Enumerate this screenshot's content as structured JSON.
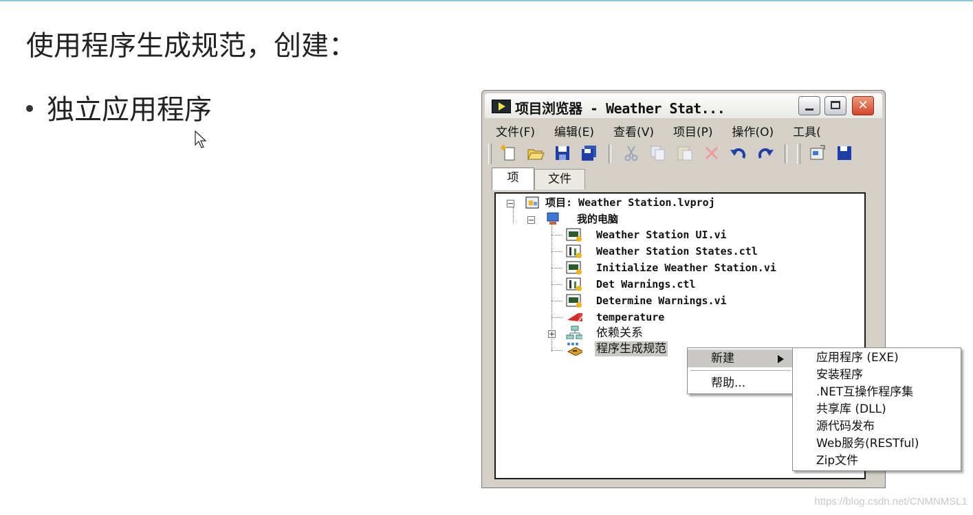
{
  "slide": {
    "title": "使用程序生成规范，创建：",
    "bullet": "独立应用程序",
    "watermark": "https://blog.csdn.net/CNMNMSL1"
  },
  "window": {
    "title": "项目浏览器 - Weather Stat...",
    "menu": [
      "文件(F)",
      "编辑(E)",
      "查看(V)",
      "项目(P)",
      "操作(O)",
      "工具("
    ],
    "tabs": [
      "项",
      "文件"
    ],
    "tree": {
      "project": "项目: Weather Station.lvproj",
      "computer": "我的电脑",
      "items": [
        {
          "label": "Weather Station UI.vi",
          "icon": "vi-icon"
        },
        {
          "label": "Weather Station States.ctl",
          "icon": "ctl-icon"
        },
        {
          "label": "Initialize Weather Station.vi",
          "icon": "vi-icon"
        },
        {
          "label": "Det Warnings.ctl",
          "icon": "ctl-icon"
        },
        {
          "label": "Determine Warnings.vi",
          "icon": "vi-icon"
        },
        {
          "label": "temperature",
          "icon": "variable-icon"
        }
      ],
      "dependencies": "依赖关系",
      "build_specs": "程序生成规范"
    }
  },
  "context_menu": {
    "new_label": "新建",
    "help_label": "帮助..."
  },
  "submenu": [
    "应用程序 (EXE)",
    "安装程序",
    ".NET互操作程序集",
    "共享库 (DLL)",
    "源代码发布",
    "Web服务(RESTful)",
    "Zip文件"
  ],
  "colors": {
    "window_bg": "#d4d0c8",
    "selection": "#c9c8c4",
    "close_button": "#d5442a"
  }
}
